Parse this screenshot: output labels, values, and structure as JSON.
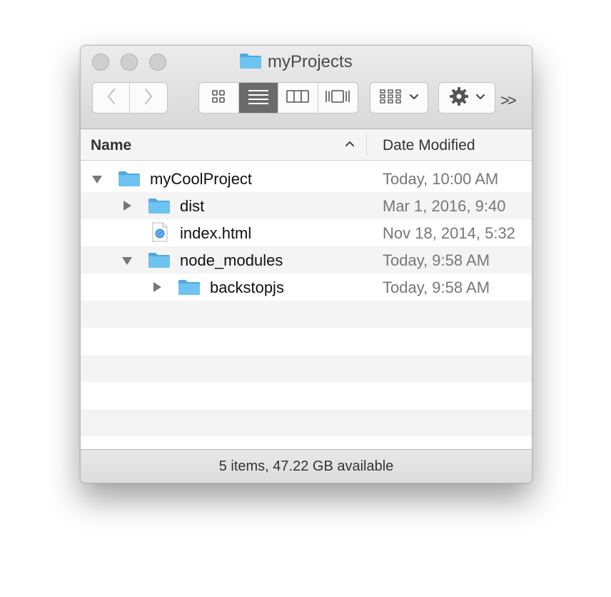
{
  "window": {
    "title": "myProjects",
    "title_icon": "folder-icon"
  },
  "toolbar": {
    "back_icon": "chevron-left-icon",
    "forward_icon": "chevron-right-icon",
    "view_modes": [
      "icon-view-icon",
      "list-view-icon",
      "column-view-icon",
      "cover-flow-view-icon"
    ],
    "active_view": "list",
    "arrange_icon": "arrange-grid-icon",
    "action_icon": "gear-icon",
    "overflow_label": ">>"
  },
  "columns": {
    "name": "Name",
    "date_modified": "Date Modified",
    "sort_indicator": "chevron-up-icon"
  },
  "files": [
    {
      "name": "myCoolProject",
      "date": "Today, 10:00 AM",
      "level": 0,
      "kind": "folder",
      "expanded": true
    },
    {
      "name": "dist",
      "date": "Mar 1, 2016, 9:40",
      "level": 1,
      "kind": "folder",
      "expanded": false
    },
    {
      "name": "index.html",
      "date": "Nov 18, 2014, 5:32",
      "level": 1,
      "kind": "html-file",
      "expanded": null
    },
    {
      "name": "node_modules",
      "date": "Today, 9:58 AM",
      "level": 1,
      "kind": "folder",
      "expanded": true
    },
    {
      "name": "backstopjs",
      "date": "Today, 9:58 AM",
      "level": 2,
      "kind": "folder",
      "expanded": false
    }
  ],
  "status": {
    "text": "5 items, 47.22 GB available"
  },
  "colors": {
    "folder": "#6ec3f0",
    "folder_dark": "#4fa9df",
    "stripe": "#f4f4f4",
    "active_segment": "#6b6b6b"
  }
}
